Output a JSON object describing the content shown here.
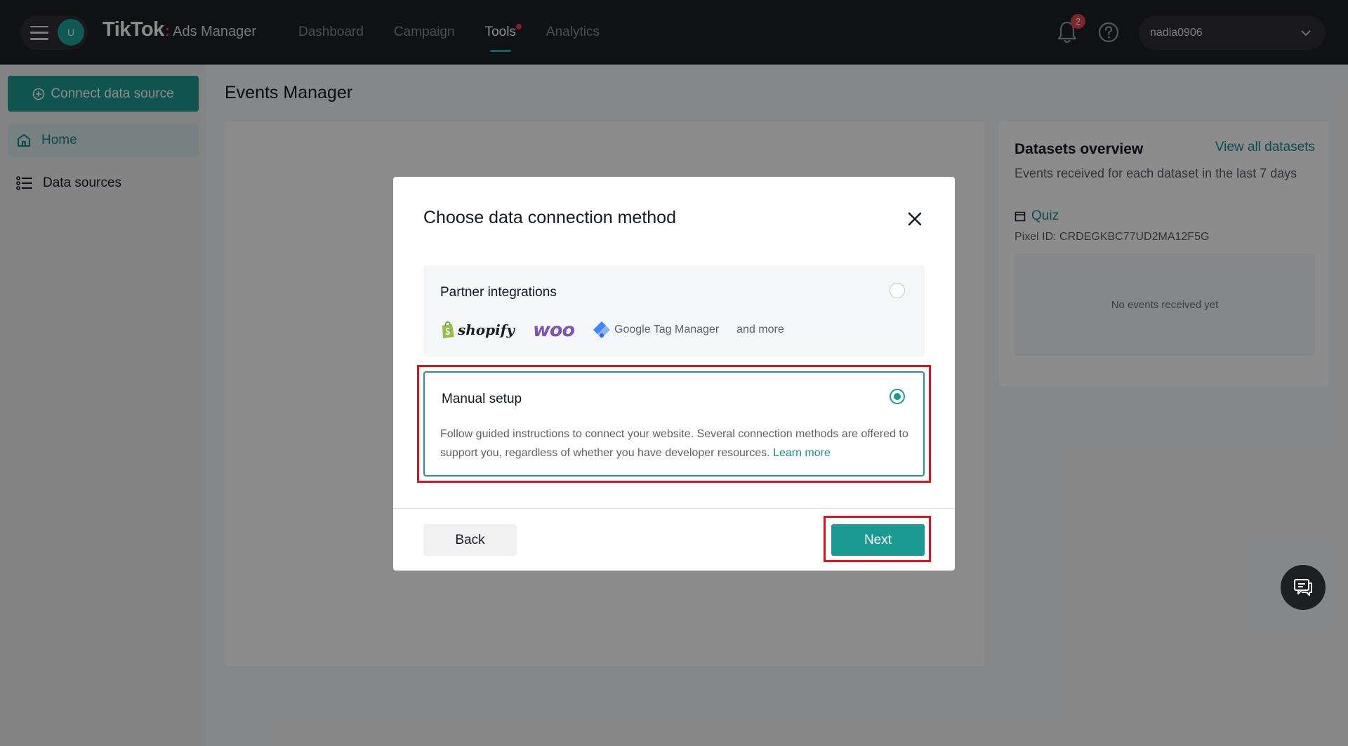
{
  "header": {
    "avatar_letter": "U",
    "logo_main": "TikTok",
    "logo_colon": ":",
    "logo_sub": "Ads Manager",
    "nav": [
      {
        "label": "Dashboard",
        "active": false
      },
      {
        "label": "Campaign",
        "active": false
      },
      {
        "label": "Tools",
        "active": true
      },
      {
        "label": "Analytics",
        "active": false
      }
    ],
    "notification_count": "2",
    "username": "nadia0906"
  },
  "sidebar": {
    "connect_label": "Connect data source",
    "items": [
      {
        "label": "Home",
        "icon": "home-icon",
        "active": true
      },
      {
        "label": "Data sources",
        "icon": "list-icon",
        "active": false
      }
    ]
  },
  "main": {
    "page_title": "Events Manager"
  },
  "datasets": {
    "title": "Datasets overview",
    "view_all": "View all datasets",
    "subtitle": "Events received for each dataset in the last 7 days",
    "dataset_name": "Quiz",
    "pixel_id": "Pixel ID: CRDEGKBC77UD2MA12F5G",
    "empty_text": "No events received yet"
  },
  "modal": {
    "title": "Choose data connection method",
    "partner": {
      "title": "Partner integrations",
      "selected": false,
      "logos": [
        "shopify",
        "woo",
        "Google Tag Manager"
      ],
      "and_more": "and more"
    },
    "manual": {
      "title": "Manual setup",
      "selected": true,
      "description": "Follow guided instructions to connect your website. Several connection methods are offered to support you, regardless of whether you have developer resources.",
      "learn_more": "Learn more"
    },
    "back_label": "Back",
    "next_label": "Next"
  },
  "colors": {
    "accent": "#1a9a91",
    "highlight": "#e0121e",
    "topbar": "#1e1f22"
  }
}
